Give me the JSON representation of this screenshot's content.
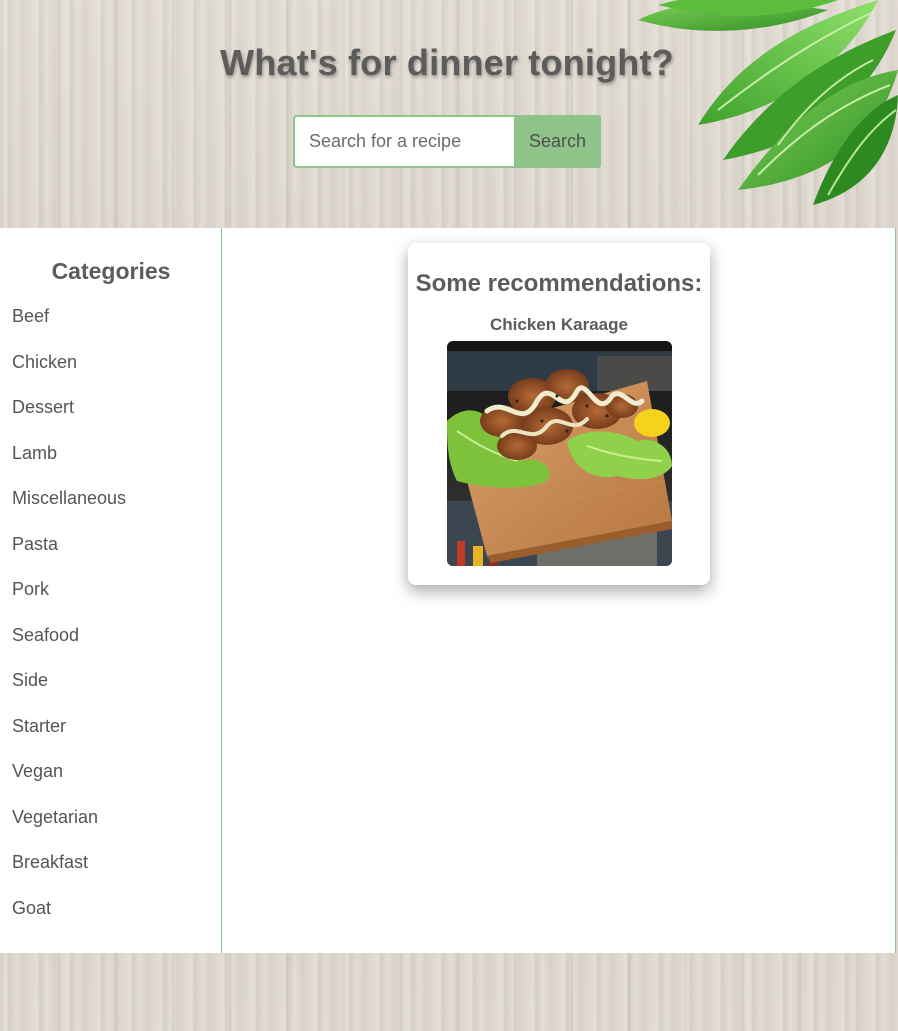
{
  "header": {
    "title": "What's for dinner tonight?",
    "search": {
      "placeholder": "Search for a recipe",
      "value": "",
      "button_label": "Search"
    }
  },
  "sidebar": {
    "title": "Categories",
    "categories": [
      "Beef",
      "Chicken",
      "Dessert",
      "Lamb",
      "Miscellaneous",
      "Pasta",
      "Pork",
      "Seafood",
      "Side",
      "Starter",
      "Vegan",
      "Vegetarian",
      "Breakfast",
      "Goat"
    ]
  },
  "recommendations": {
    "heading": "Some recommendations:",
    "items": [
      {
        "name": "Chicken Karaage",
        "image": "fried-chicken-on-cutting-board"
      }
    ]
  },
  "colors": {
    "accent": "#8ec48a",
    "text": "#5c5c5c",
    "panel": "#ffffff",
    "wood": "#ddd6cc"
  }
}
